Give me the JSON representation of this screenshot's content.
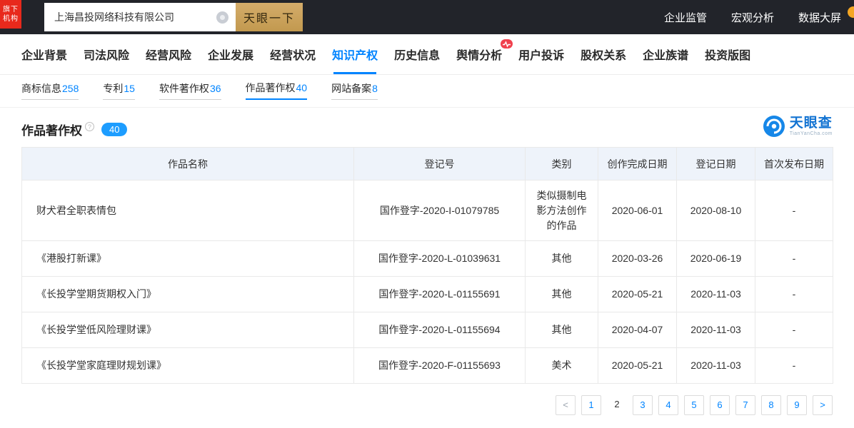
{
  "topbar": {
    "badge_line1": "旗下",
    "badge_line2": "机构",
    "search_value": "上海昌投网络科技有限公司",
    "search_button": "天眼一下",
    "links": [
      "企业监管",
      "宏观分析",
      "数据大屏"
    ]
  },
  "tabs": [
    {
      "label": "企业背景"
    },
    {
      "label": "司法风险"
    },
    {
      "label": "经营风险"
    },
    {
      "label": "企业发展"
    },
    {
      "label": "经营状况"
    },
    {
      "label": "知识产权",
      "active": true
    },
    {
      "label": "历史信息"
    },
    {
      "label": "舆情分析",
      "has_badge": true
    },
    {
      "label": "用户投诉"
    },
    {
      "label": "股权关系"
    },
    {
      "label": "企业族谱"
    },
    {
      "label": "投资版图"
    }
  ],
  "subtabs": [
    {
      "label": "商标信息",
      "count": "258"
    },
    {
      "label": "专利",
      "count": "15"
    },
    {
      "label": "软件著作权",
      "count": "36"
    },
    {
      "label": "作品著作权",
      "count": "40",
      "active": true
    },
    {
      "label": "网站备案",
      "count": "8"
    }
  ],
  "section": {
    "title": "作品著作权",
    "help": "?",
    "count_badge": "40"
  },
  "logo": {
    "name": "天眼查",
    "domain": "TianYanCha.com"
  },
  "table": {
    "headers": [
      "作品名称",
      "登记号",
      "类别",
      "创作完成日期",
      "登记日期",
      "首次发布日期"
    ],
    "rows": [
      {
        "name": "财犬君全职表情包",
        "reg_no": "国作登字-2020-I-01079785",
        "category": "类似摄制电影方法创作的作品",
        "finish_date": "2020-06-01",
        "reg_date": "2020-08-10",
        "first_publish": "-"
      },
      {
        "name": "《港股打新课》",
        "reg_no": "国作登字-2020-L-01039631",
        "category": "其他",
        "finish_date": "2020-03-26",
        "reg_date": "2020-06-19",
        "first_publish": "-"
      },
      {
        "name": "《长投学堂期货期权入门》",
        "reg_no": "国作登字-2020-L-01155691",
        "category": "其他",
        "finish_date": "2020-05-21",
        "reg_date": "2020-11-03",
        "first_publish": "-"
      },
      {
        "name": "《长投学堂低风险理财课》",
        "reg_no": "国作登字-2020-L-01155694",
        "category": "其他",
        "finish_date": "2020-04-07",
        "reg_date": "2020-11-03",
        "first_publish": "-"
      },
      {
        "name": "《长投学堂家庭理财规划课》",
        "reg_no": "国作登字-2020-F-01155693",
        "category": "美术",
        "finish_date": "2020-05-21",
        "reg_date": "2020-11-03",
        "first_publish": "-"
      }
    ]
  },
  "pagination": {
    "prev": "<",
    "next": ">",
    "pages": [
      "1",
      "2",
      "3",
      "4",
      "5",
      "6",
      "7",
      "8",
      "9"
    ],
    "current": "2"
  },
  "colors": {
    "accent_blue": "#0084ff",
    "badge_blue": "#1d9dff",
    "gold_button": "#c9a158",
    "topbar_bg": "#22242a",
    "brand_red": "#e8291c",
    "table_header_bg": "#eef3fa"
  }
}
